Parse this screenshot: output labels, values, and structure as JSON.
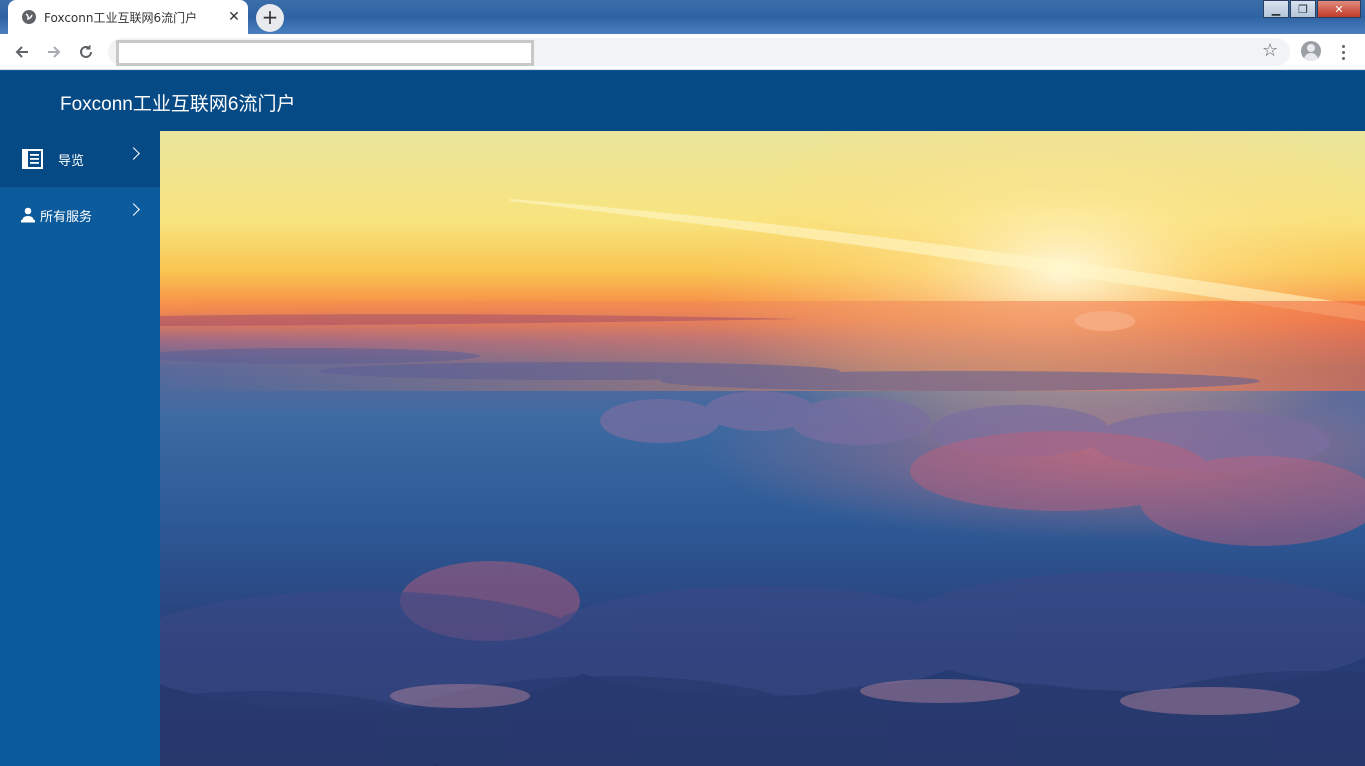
{
  "browser": {
    "tab_title": "Foxconn工业互联网6流门户",
    "address_value": "",
    "new_tab_symbol": "+",
    "close_tab_symbol": "✕",
    "window_controls": {
      "minimize": "▁",
      "restore": "❐",
      "close": "✕"
    }
  },
  "app": {
    "title": "Foxconn工业互联网6流门户"
  },
  "sidebar": {
    "items": [
      {
        "label": "导览",
        "icon": "document-list-icon",
        "active": true
      },
      {
        "label": "所有服务",
        "icon": "user-service-icon",
        "active": false
      }
    ]
  },
  "colors": {
    "header": "#064a85",
    "sidebar": "#0c5b9c",
    "sidebar_active": "#064a85"
  }
}
